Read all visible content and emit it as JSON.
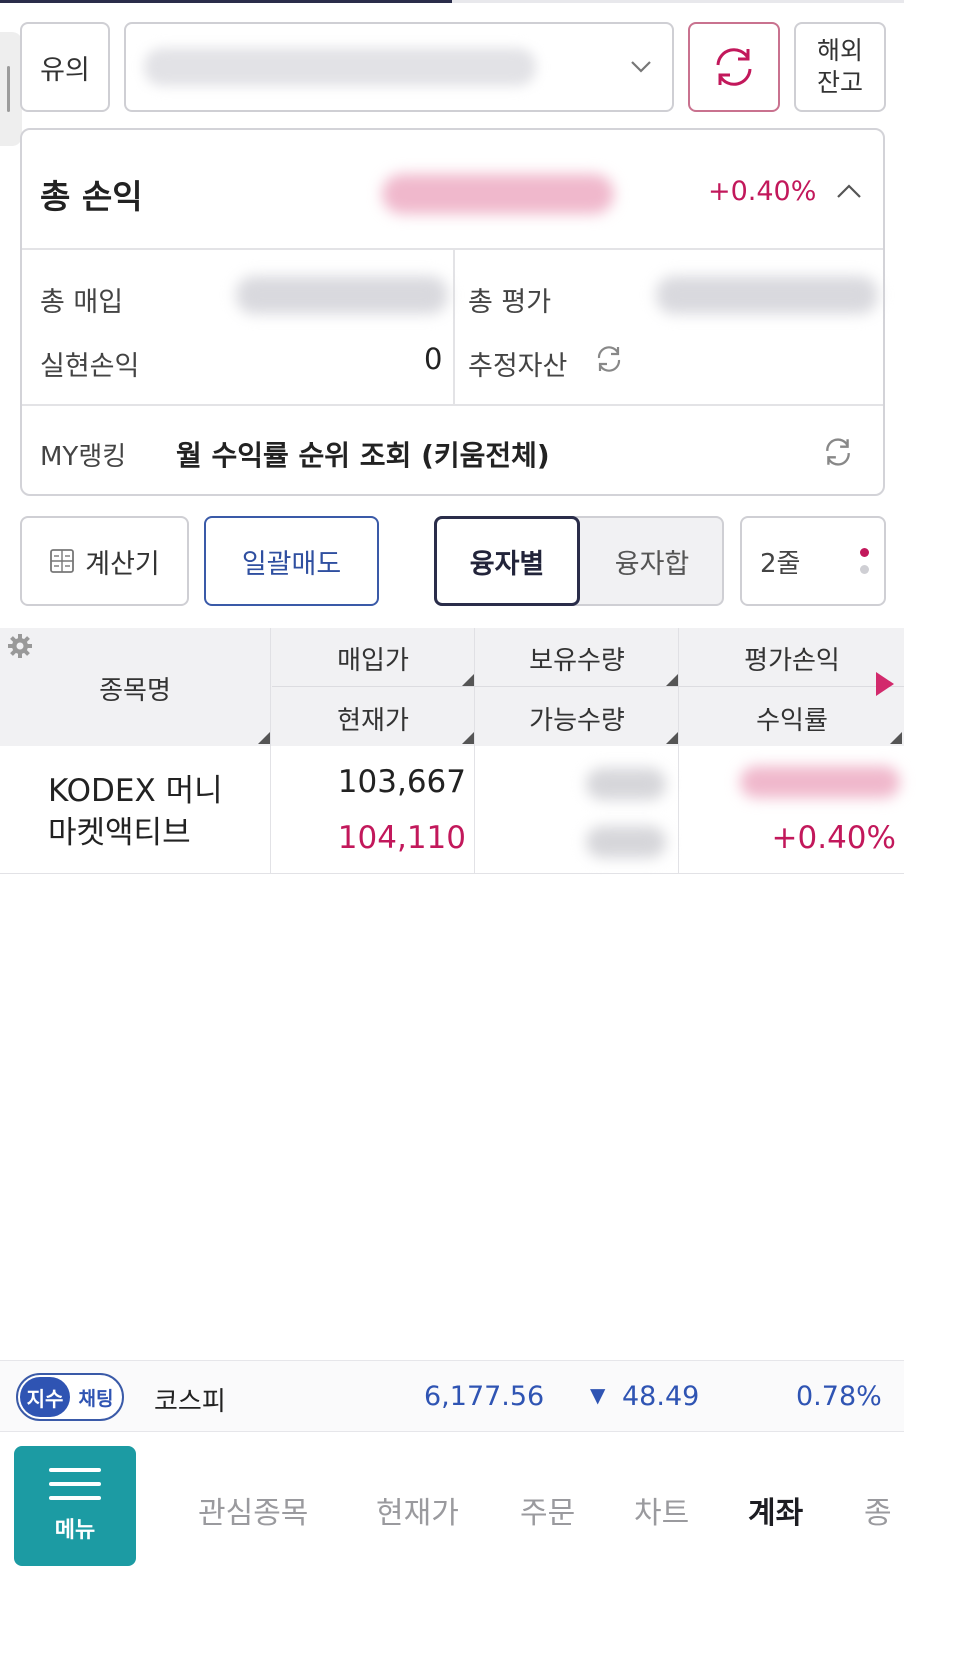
{
  "header": {
    "notice_label": "유의",
    "account_selector_icon": "chevron-down-icon",
    "refresh_icon": "refresh-icon",
    "overseas_label_line1": "해외",
    "overseas_label_line2": "잔고"
  },
  "summary": {
    "total_pnl_label": "총 손익",
    "total_pnl_pct": "+0.40%",
    "total_buy_label": "총 매입",
    "total_eval_label": "총 평가",
    "realized_pnl_label": "실현손익",
    "realized_pnl_value": "0",
    "est_assets_label": "추정자산",
    "my_ranking_label": "MY랭킹",
    "my_ranking_text": "월 수익률 순위 조회 (키움전체)"
  },
  "toolbar": {
    "calculator_label": "계산기",
    "bulk_sell_label": "일괄매도",
    "by_loan_label": "융자별",
    "loan_sum_label": "융자합",
    "lines_label": "2줄"
  },
  "table": {
    "headers": {
      "name": "종목명",
      "buy_price": "매입가",
      "current_price": "현재가",
      "holding_qty": "보유수량",
      "available_qty": "가능수량",
      "eval_pnl": "평가손익",
      "return_rate": "수익률"
    },
    "rows": [
      {
        "name_line1": "KODEX 머니",
        "name_line2": "마켓액티브",
        "buy_price": "103,667",
        "current_price": "104,110",
        "return_rate": "+0.40%"
      }
    ]
  },
  "ticker": {
    "tab_index": "지수",
    "tab_chat": "채팅",
    "index_name": "코스피",
    "index_value": "6,177.56",
    "change_arrow": "▼",
    "change_value": "48.49",
    "change_pct": "0.78%"
  },
  "bottom_nav": {
    "menu_label": "메뉴",
    "items": [
      "관심종목",
      "현재가",
      "주문",
      "차트",
      "계좌",
      "종"
    ],
    "active": "계좌"
  },
  "colors": {
    "up_red": "#c2185b",
    "down_blue": "#2f54b3",
    "navy": "#2a2d4a",
    "teal": "#1c9ba3"
  }
}
